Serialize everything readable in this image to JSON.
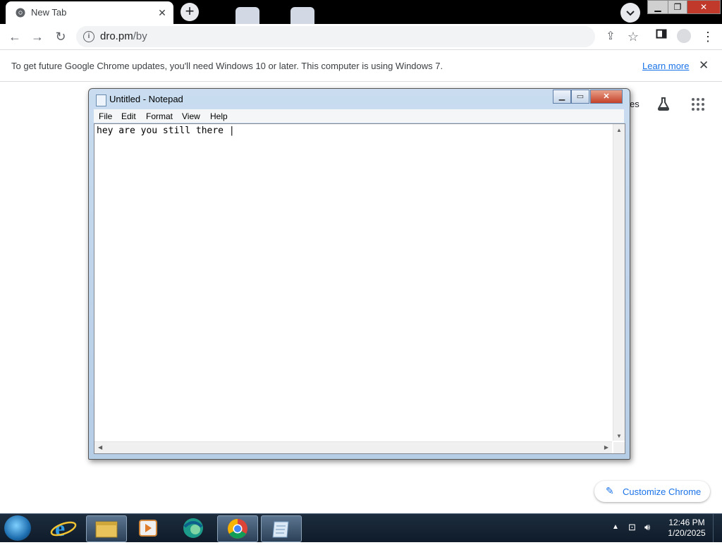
{
  "browser": {
    "tab_title": "New Tab",
    "tab_close": "✕",
    "new_tab": "+",
    "url_host": "dro.pm",
    "url_path": "/by",
    "infobar_message": "To get future Google Chrome updates, you'll need Windows 10 or later. This computer is using Windows 7.",
    "infobar_link": "Learn more",
    "infobar_close": "✕"
  },
  "page": {
    "partial_text": "es",
    "customize_label": "Customize Chrome"
  },
  "notepad": {
    "title": "Untitled - Notepad",
    "menu": [
      "File",
      "Edit",
      "Format",
      "View",
      "Help"
    ],
    "content": "hey are you still there |"
  },
  "taskbar": {
    "time": "12:46 PM",
    "date": "1/20/2025",
    "apps": [
      "ie-icon",
      "explorer-icon",
      "media-player-icon",
      "edge-icon",
      "chrome-icon",
      "notepad-icon"
    ]
  },
  "colors": {
    "accent": "#1a73e8",
    "tabstrip": "#000000",
    "taskbar": "#1d2d3e"
  }
}
